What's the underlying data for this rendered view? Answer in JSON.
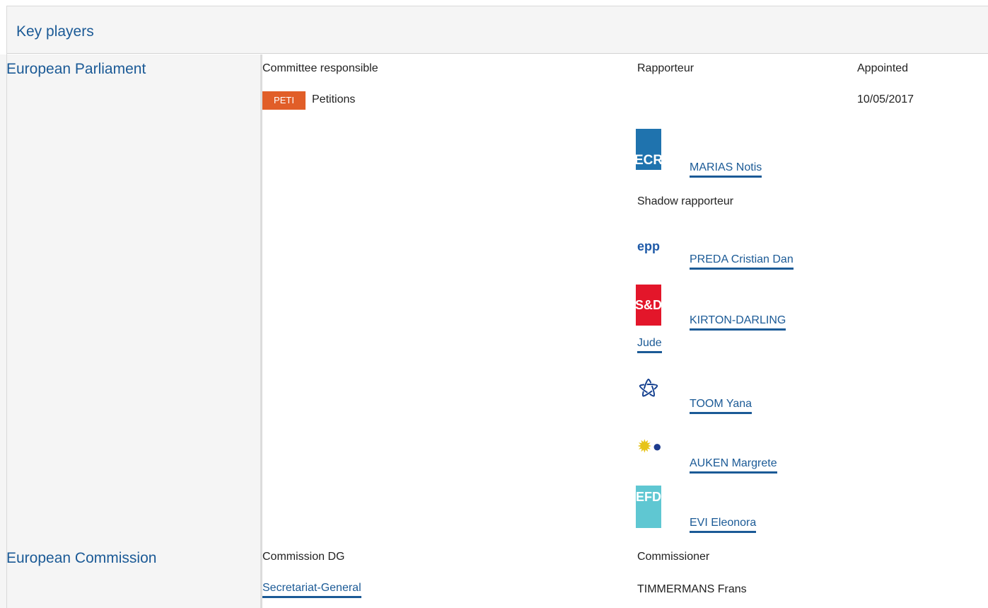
{
  "header": {
    "title": "Key players"
  },
  "parliament": {
    "title": "European Parliament",
    "committee_header": "Committee responsible",
    "rapporteur_header": "Rapporteur",
    "appointed_header": "Appointed",
    "committee_badge": "PETI",
    "committee_name": "Petitions",
    "appointed_date": "10/05/2017",
    "rapporteur": {
      "group": "ECR",
      "name": "MARIAS Notis"
    },
    "shadow_header": "Shadow rapporteur",
    "shadows": [
      {
        "group": "epp",
        "name": "PREDA Cristian Dan"
      },
      {
        "group": "S&D",
        "name_line1": "KIRTON-DARLING",
        "name_line2": "Jude"
      },
      {
        "group": "GUE/NGL",
        "name": "TOOM Yana"
      },
      {
        "group": "Greens/EFA",
        "name": "AUKEN Margrete"
      },
      {
        "group": "EFD",
        "name": "EVI Eleonora"
      }
    ]
  },
  "commission": {
    "title": "European Commission",
    "dg_header": "Commission DG",
    "commissioner_header": "Commissioner",
    "dg_name": "Secretariat-General",
    "commissioner_name": "TIMMERMANS Frans"
  },
  "colors": {
    "link": "#1b5a96",
    "badge": "#e15e28",
    "panel": "#f5f5f5"
  }
}
